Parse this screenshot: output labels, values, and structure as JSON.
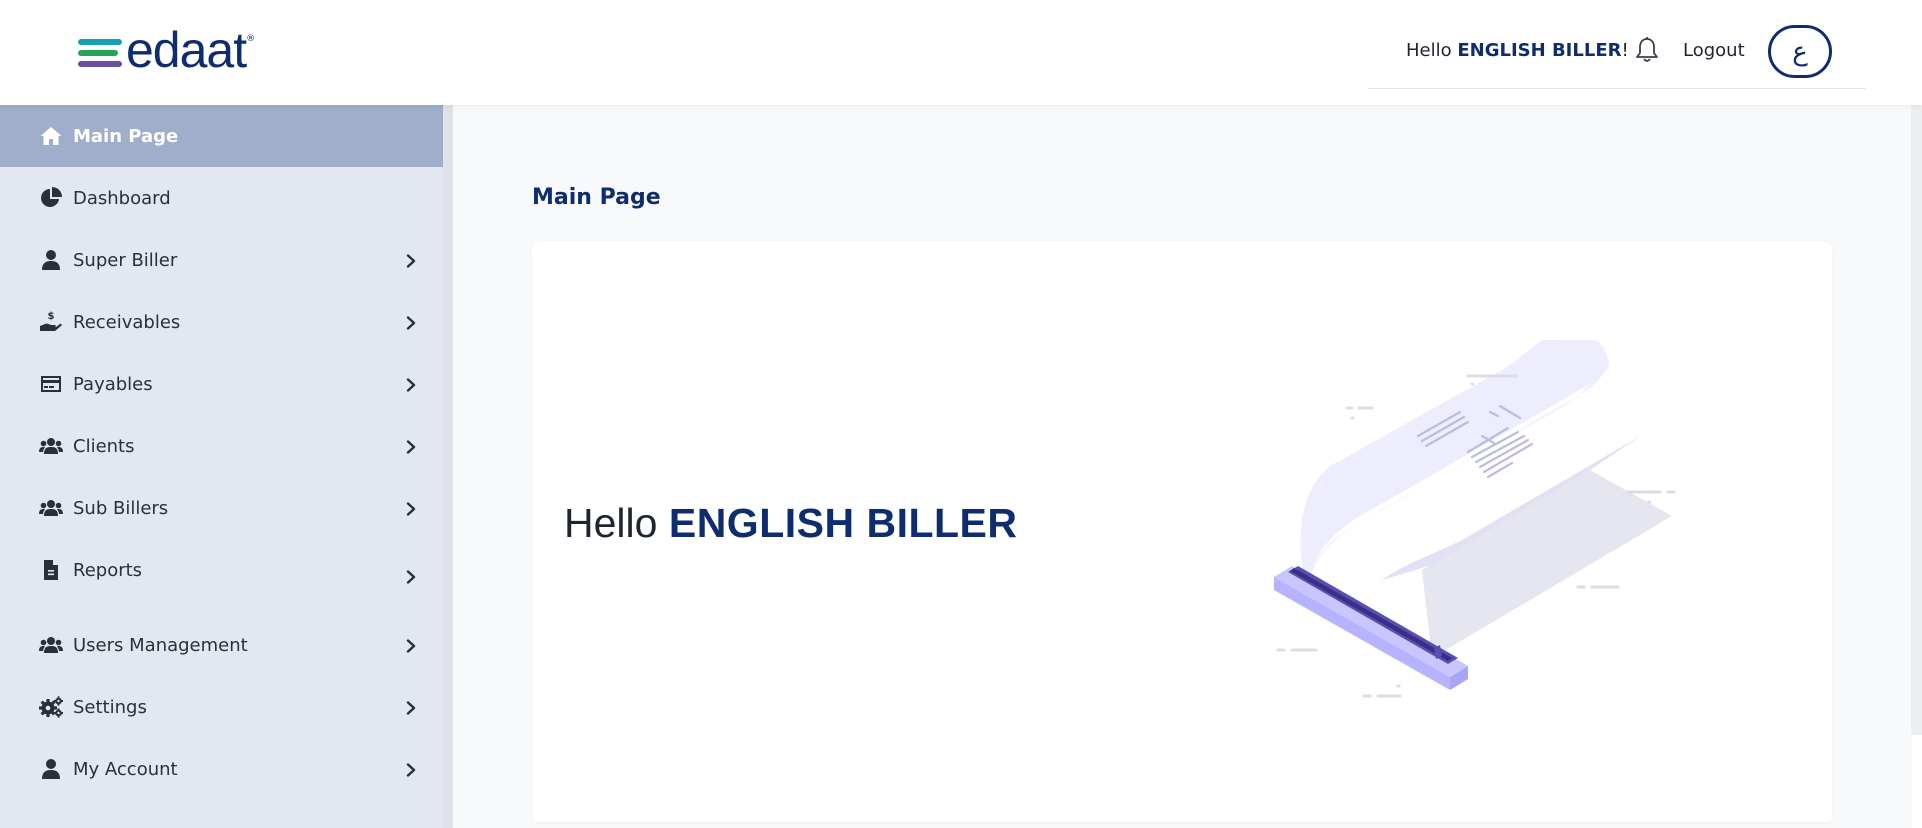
{
  "header": {
    "logo_text": "edaat",
    "logo_tm": "®",
    "greeting_prefix": "Hello",
    "user_name": "ENGLISH BILLER",
    "greeting_suffix": "!",
    "logout_label": "Logout",
    "language_toggle": "ع",
    "icons": {
      "notifications": "bell-icon"
    }
  },
  "sidebar": {
    "items": [
      {
        "label": "Main Page",
        "icon": "home-icon",
        "active": true,
        "has_submenu": false
      },
      {
        "label": "Dashboard",
        "icon": "pie-chart-icon",
        "active": false,
        "has_submenu": false
      },
      {
        "label": "Super Biller",
        "icon": "user-icon",
        "active": false,
        "has_submenu": true
      },
      {
        "label": "Receivables",
        "icon": "hand-dollar-icon",
        "active": false,
        "has_submenu": true
      },
      {
        "label": "Payables",
        "icon": "credit-card-icon",
        "active": false,
        "has_submenu": true
      },
      {
        "label": "Clients",
        "icon": "users-icon",
        "active": false,
        "has_submenu": true
      },
      {
        "label": "Sub Billers",
        "icon": "users-icon",
        "active": false,
        "has_submenu": true
      },
      {
        "label": "Reports",
        "icon": "file-icon",
        "active": false,
        "has_submenu": true
      },
      {
        "label": "Users Management",
        "icon": "users-icon",
        "active": false,
        "has_submenu": true
      },
      {
        "label": "Settings",
        "icon": "gears-icon",
        "active": false,
        "has_submenu": true
      },
      {
        "label": "My Account",
        "icon": "user-icon",
        "active": false,
        "has_submenu": true
      }
    ]
  },
  "main": {
    "page_title": "Main Page",
    "welcome_prefix": "Hello",
    "welcome_name": "ENGLISH BILLER"
  },
  "colors": {
    "brand_navy": "#0f2d6e",
    "sidebar_bg": "#e3e7ef",
    "sidebar_active": "#9faecb",
    "illustration_lavender": "#c9c6ff"
  }
}
